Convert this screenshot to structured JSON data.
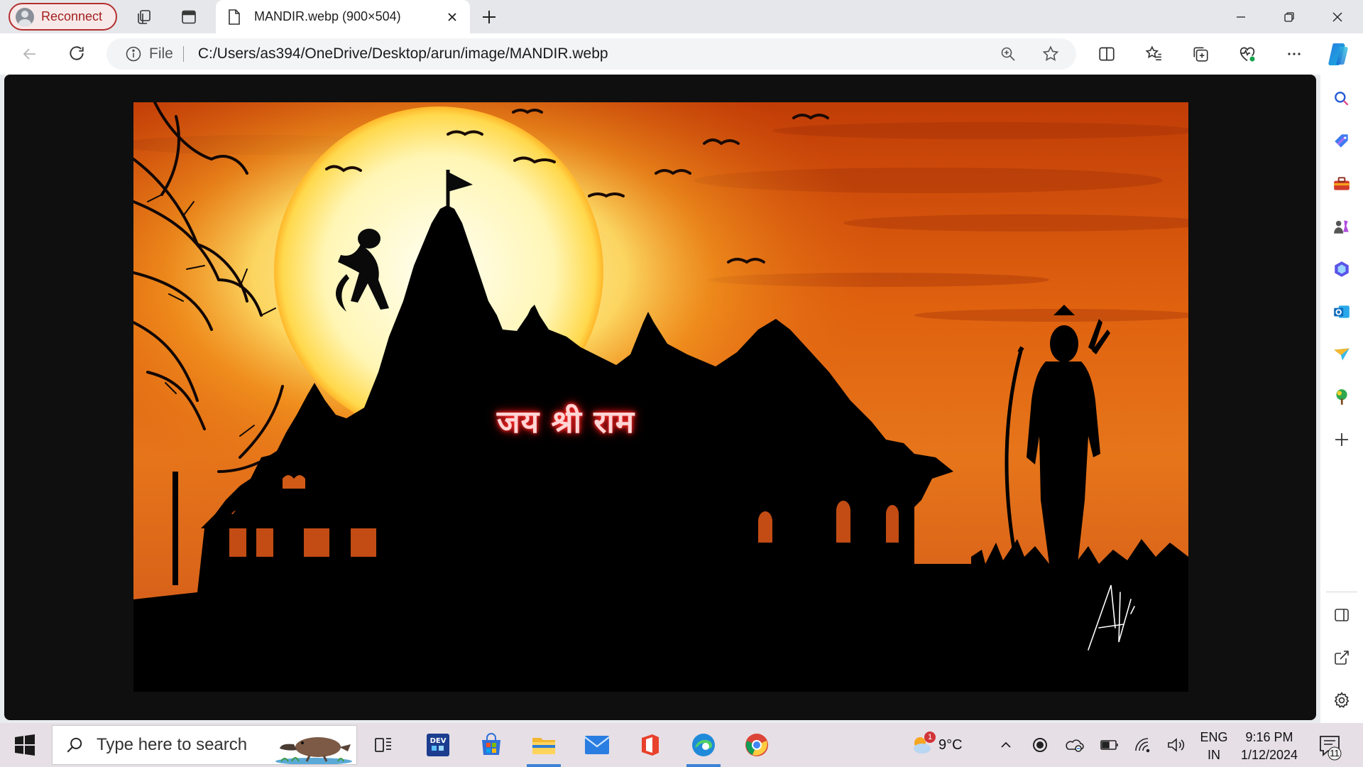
{
  "browser": {
    "profile_label": "Reconnect",
    "tab_title": "MANDIR.webp (900×504)",
    "address_scheme": "File",
    "address_url": "C:/Users/as394/OneDrive/Desktop/arun/image/MANDIR.webp",
    "accent_color": "#1a73e8"
  },
  "image": {
    "overlay_text": "जय श्री राम",
    "signature_text": "Arv"
  },
  "sidebar": {
    "items": [
      "search-icon",
      "shopping-tag-icon",
      "tools-icon",
      "games-icon",
      "copilot-icon",
      "outlook-icon",
      "drop-icon",
      "tree-icon",
      "add-icon",
      "split-screen-icon",
      "external-link-icon",
      "settings-icon"
    ]
  },
  "taskbar": {
    "search_placeholder": "Type here to search",
    "weather_temp": "9°C",
    "weather_badge": "1",
    "lang_top": "ENG",
    "lang_bottom": "IN",
    "time": "9:16 PM",
    "date": "1/12/2024",
    "notification_count": "11"
  }
}
